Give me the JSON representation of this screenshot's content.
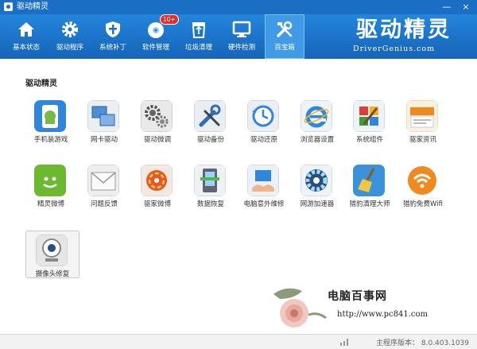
{
  "window": {
    "title": "驱动精灵",
    "min_label": "—",
    "close_label": "×"
  },
  "toolbar": {
    "items": [
      {
        "label": "基本状态",
        "icon": "home-icon"
      },
      {
        "label": "驱动程序",
        "icon": "gear-icon"
      },
      {
        "label": "系统补丁",
        "icon": "shield-icon"
      },
      {
        "label": "软件管理",
        "icon": "disc-icon",
        "badge": "10+"
      },
      {
        "label": "垃圾清理",
        "icon": "recycle-bin-icon"
      },
      {
        "label": "硬件检测",
        "icon": "monitor-icon"
      },
      {
        "label": "百宝箱",
        "icon": "tools-icon",
        "active": true
      }
    ]
  },
  "brand": {
    "name_cn": "驱动精灵",
    "name_en": "DriverGenius.com"
  },
  "section": {
    "title": "驱动精灵"
  },
  "apps": [
    {
      "label": "手机装游戏",
      "icon": "android-phone-icon"
    },
    {
      "label": "网卡驱动",
      "icon": "network-card-icon"
    },
    {
      "label": "驱动微调",
      "icon": "gears-icon"
    },
    {
      "label": "驱动备份",
      "icon": "wrench-screwdriver-icon"
    },
    {
      "label": "驱动还原",
      "icon": "restore-clock-icon"
    },
    {
      "label": "浏览器设置",
      "icon": "ie-browser-icon"
    },
    {
      "label": "系统组件",
      "icon": "paint-palette-icon"
    },
    {
      "label": "驱家资讯",
      "icon": "news-icon"
    },
    {
      "label": "精灵微博",
      "icon": "chat-bubble-icon"
    },
    {
      "label": "问题反馈",
      "icon": "envelope-icon"
    },
    {
      "label": "驱家微博",
      "icon": "spiral-logo-icon"
    },
    {
      "label": "数据恢复",
      "icon": "disk-recovery-icon"
    },
    {
      "label": "电脑意外维修",
      "icon": "repair-hands-icon"
    },
    {
      "label": "网游加速器",
      "icon": "turbine-fan-icon"
    },
    {
      "label": "猎豹清理大师",
      "icon": "broom-icon"
    },
    {
      "label": "猎豹免费Wifi",
      "icon": "wifi-icon"
    },
    {
      "label": "摄像头修复",
      "icon": "webcam-icon"
    }
  ],
  "status": {
    "version_label": "主程序版本：",
    "version": "8.0.403.1039"
  },
  "watermark": {
    "title": "电脑百事网",
    "url": "http://www.pc841.com"
  },
  "colors": {
    "toolbar": "#1a6fc4",
    "active_tab": "#3f9be8",
    "badge": "#e72b2b"
  }
}
